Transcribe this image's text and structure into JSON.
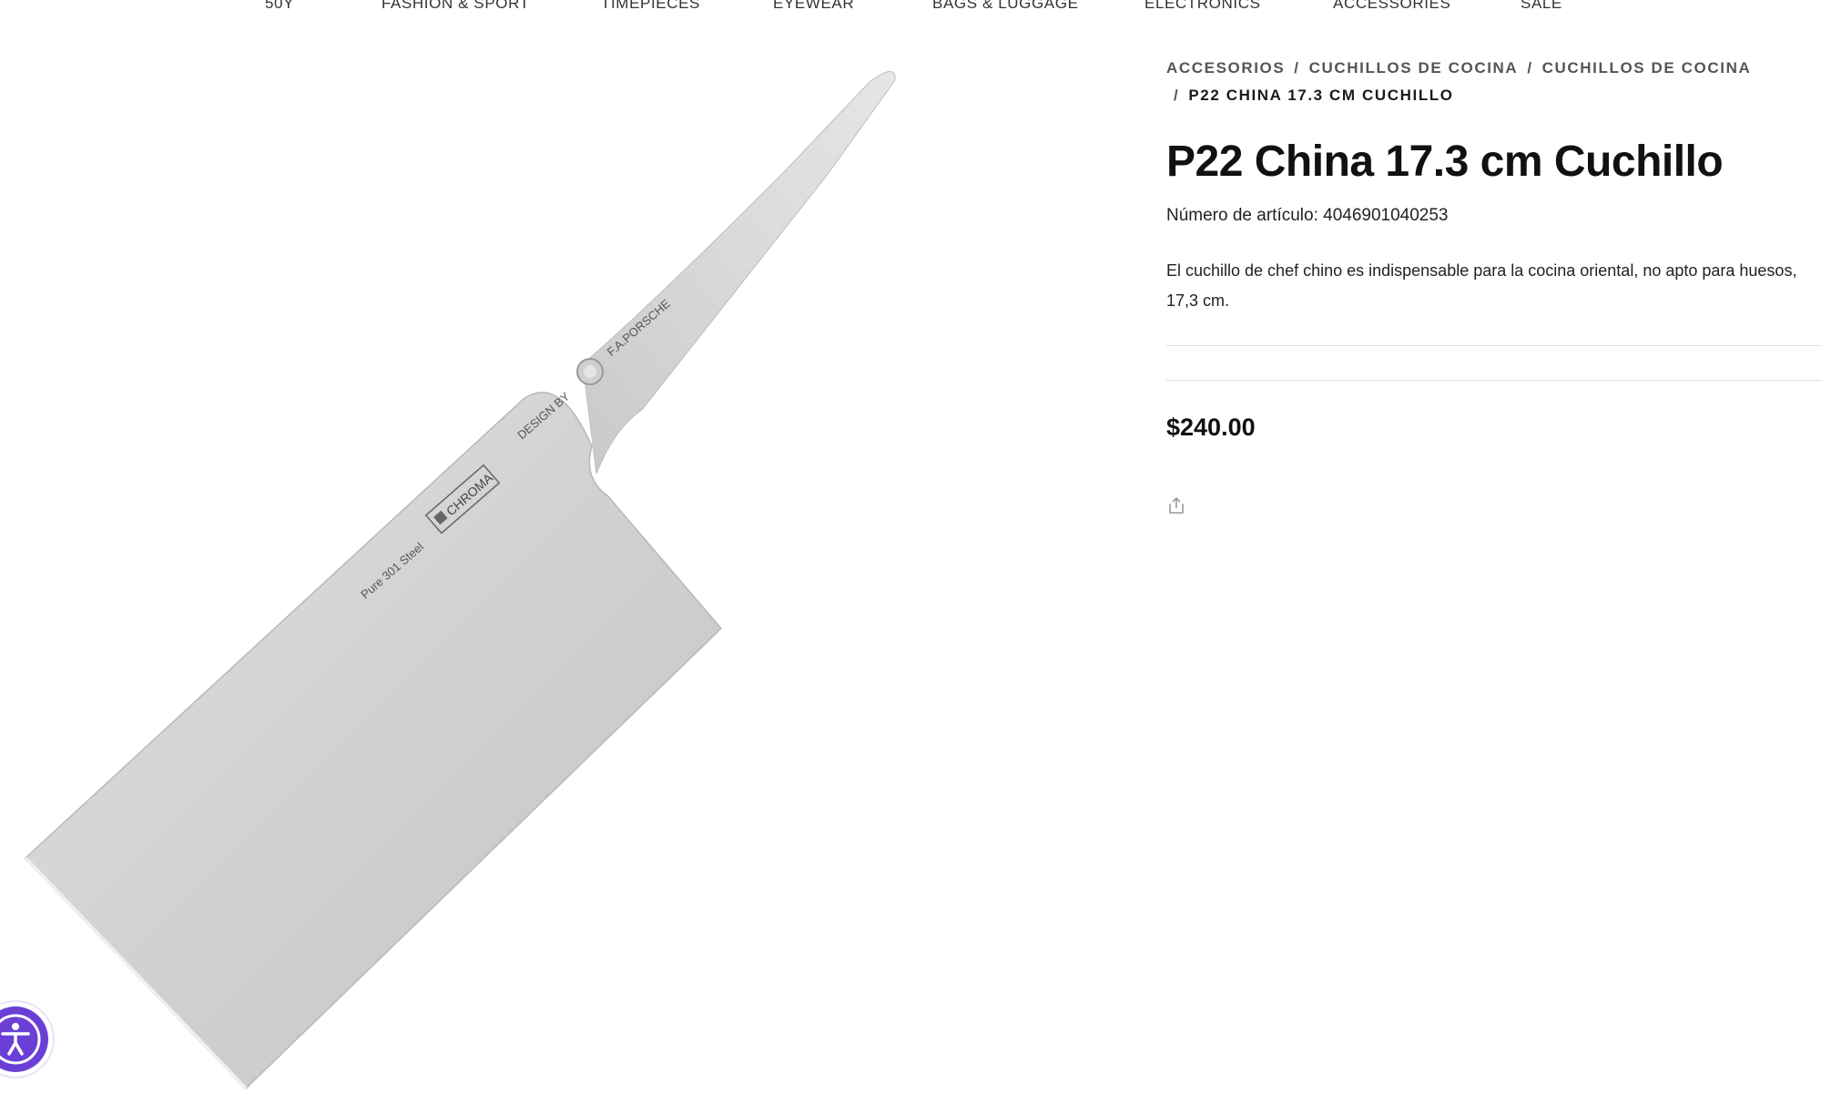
{
  "nav": {
    "items": [
      "50Y",
      "FASHION & SPORT",
      "TIMEPIECES",
      "EYEWEAR",
      "BAGS & LUGGAGE",
      "ELECTRONICS",
      "ACCESSORIES",
      "SALE"
    ]
  },
  "product_image": {
    "brand_text": "CHROMA",
    "steel_text": "Pure 301  Steel",
    "design_text": "DESIGN BY",
    "designer_text": "F.A.PORSCHE"
  },
  "breadcrumb": {
    "items": [
      "ACCESORIOS",
      "CUCHILLOS DE COCINA",
      "CUCHILLOS DE COCINA"
    ],
    "current": "P22 CHINA 17.3 CM CUCHILLO",
    "separator": "/"
  },
  "product": {
    "title": "P22 China 17.3 cm Cuchillo",
    "sku": "Número de artículo: 4046901040253",
    "description": "El cuchillo de chef chino es indispensable para la cocina oriental, no apto para huesos, 17,3 cm.",
    "price": "$240.00"
  },
  "icons": {
    "share": "share-icon",
    "accessibility": "accessibility-icon"
  },
  "colors": {
    "accent": "#6b3fd6",
    "text": "#111111"
  }
}
